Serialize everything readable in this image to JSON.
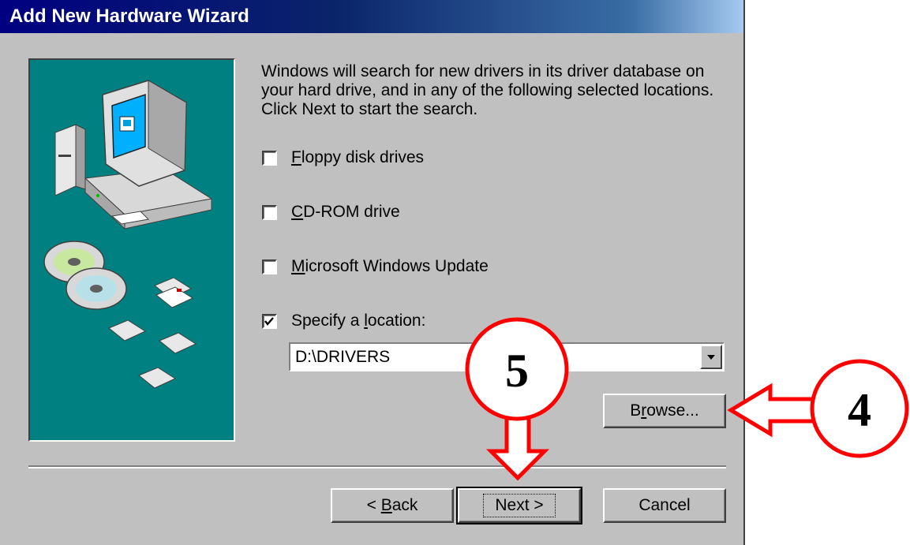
{
  "window": {
    "title": "Add New Hardware Wizard"
  },
  "instructions": "Windows will search for new drivers in its driver database on your hard drive, and in any of the following selected locations. Click Next to start the search.",
  "options": [
    {
      "label_mnemonic": "F",
      "label_rest": "loppy disk drives",
      "checked": false
    },
    {
      "label_mnemonic": "C",
      "label_rest": "D-ROM drive",
      "checked": false
    },
    {
      "label_mnemonic": "M",
      "label_rest": "icrosoft Windows Update",
      "checked": false
    },
    {
      "label_pre": "Specify a ",
      "label_mnemonic": "l",
      "label_rest": "ocation:",
      "checked": true
    }
  ],
  "location": {
    "value": "D:\\DRIVERS"
  },
  "buttons": {
    "browse": {
      "pre": "B",
      "mnemonic": "r",
      "rest": "owse..."
    },
    "back": {
      "pre": "< ",
      "mnemonic": "B",
      "rest": "ack"
    },
    "next": {
      "label": "Next >"
    },
    "cancel": {
      "label": "Cancel"
    }
  },
  "annotations": {
    "step_browse": "4",
    "step_next": "5"
  },
  "colors": {
    "title_start": "#000080",
    "title_end": "#a6caf0",
    "face": "#c0c0c0",
    "art_bg": "#008080",
    "annotation_red": "#ff0000"
  },
  "icons": [
    "computer-icon",
    "cd-icon",
    "floppy-icon",
    "dropdown-arrow-icon",
    "checkmark-icon",
    "arrow-icon"
  ]
}
